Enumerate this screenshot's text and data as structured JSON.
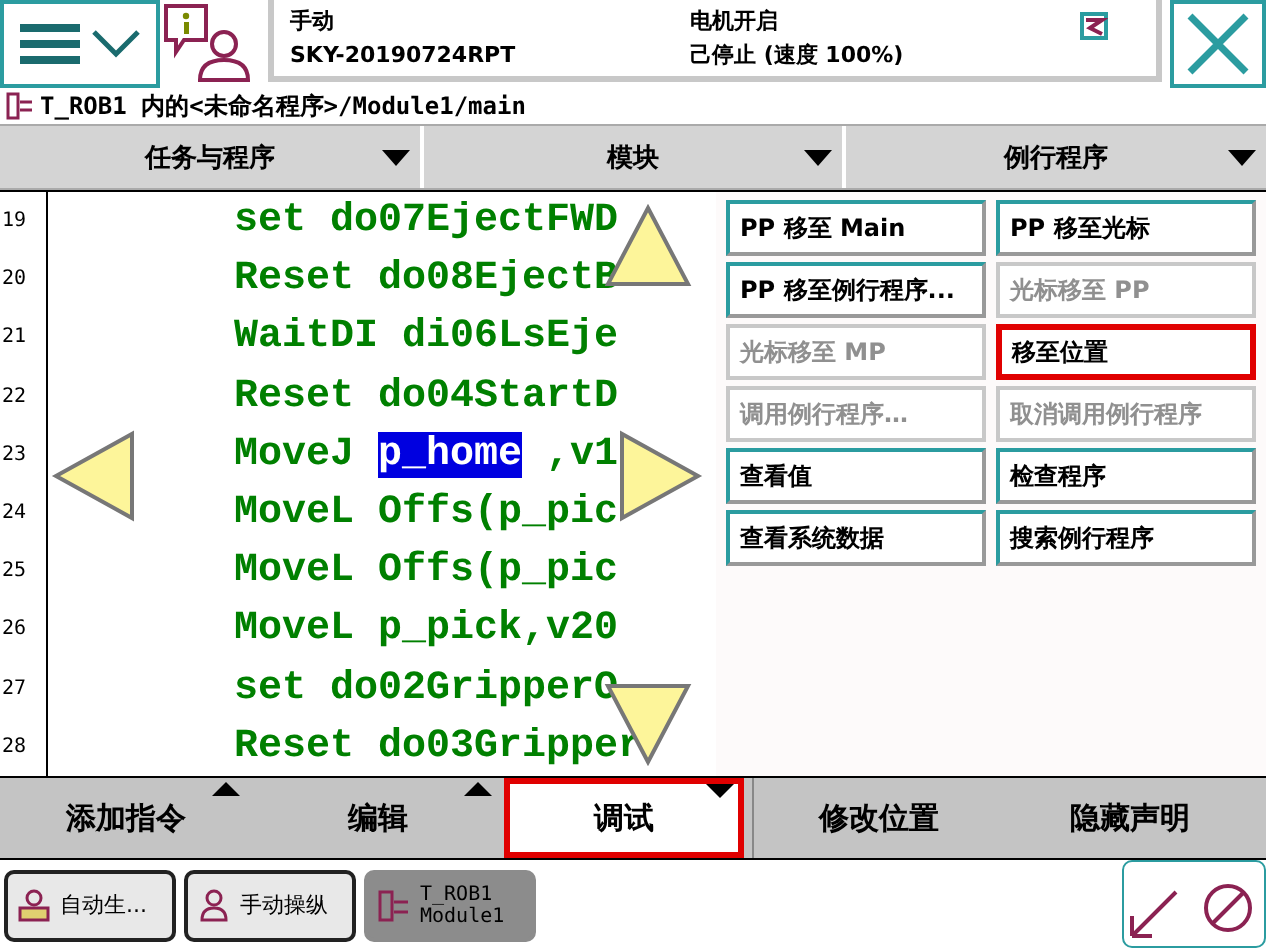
{
  "header": {
    "mode": "手动",
    "system": "SKY-20190724RPT",
    "motor": "电机开启",
    "state": "己停止 (速度 100%)"
  },
  "path": "T_ROB1 内的<未命名程序>/Module1/main",
  "column_heads": [
    {
      "label": "任务与程序"
    },
    {
      "label": "模块"
    },
    {
      "label": "例行程序"
    }
  ],
  "code": {
    "lines": [
      {
        "number": "19",
        "text": "set do07EjectFWD"
      },
      {
        "number": "20",
        "text": "Reset do08EjectB"
      },
      {
        "number": "21",
        "text": "WaitDI di06LsEje"
      },
      {
        "number": "22",
        "text": "Reset do04StartD"
      },
      {
        "number": "23",
        "text": "MoveJ ",
        "selection": "p_home",
        "after": " ,v1"
      },
      {
        "number": "24",
        "text": "MoveL Offs(p_pic"
      },
      {
        "number": "25",
        "text": "MoveL Offs(p_pic"
      },
      {
        "number": "26",
        "text": "MoveL p_pick,v20"
      },
      {
        "number": "27",
        "text": "set do02GripperO"
      },
      {
        "number": "28",
        "text": "Reset do03Gripper"
      }
    ]
  },
  "debug_menu": [
    {
      "label": "PP 移至 Main",
      "disabled": false,
      "selected": false
    },
    {
      "label": "PP 移至光标",
      "disabled": false,
      "selected": false
    },
    {
      "label": "PP 移至例行程序...",
      "disabled": false,
      "selected": false
    },
    {
      "label": "光标移至 PP",
      "disabled": true,
      "selected": false
    },
    {
      "label": "光标移至 MP",
      "disabled": true,
      "selected": false
    },
    {
      "label": "移至位置",
      "disabled": false,
      "selected": true
    },
    {
      "label": "调用例行程序…",
      "disabled": true,
      "selected": false
    },
    {
      "label": "取消调用例行程序",
      "disabled": true,
      "selected": false
    },
    {
      "label": "查看值",
      "disabled": false,
      "selected": false
    },
    {
      "label": "检查程序",
      "disabled": false,
      "selected": false
    },
    {
      "label": "查看系统数据",
      "disabled": false,
      "selected": false
    },
    {
      "label": "搜索例行程序",
      "disabled": false,
      "selected": false
    }
  ],
  "toolbar": [
    {
      "label": "添加指令",
      "selected": false,
      "kind": "menu"
    },
    {
      "label": "编辑",
      "selected": false,
      "kind": "menu"
    },
    {
      "label": "调试",
      "selected": true,
      "kind": "menu"
    },
    {
      "label": "修改位置",
      "selected": false,
      "kind": "plain"
    },
    {
      "label": "隐藏声明",
      "selected": false,
      "kind": "plain"
    }
  ],
  "taskbar": [
    {
      "lines": [
        "自动生..."
      ],
      "selected": false,
      "kind": "auto"
    },
    {
      "lines": [
        "手动操纵"
      ],
      "selected": false,
      "kind": "jog"
    },
    {
      "lines": [
        "T_ROB1",
        "Module1"
      ],
      "selected": true,
      "kind": "program"
    }
  ]
}
